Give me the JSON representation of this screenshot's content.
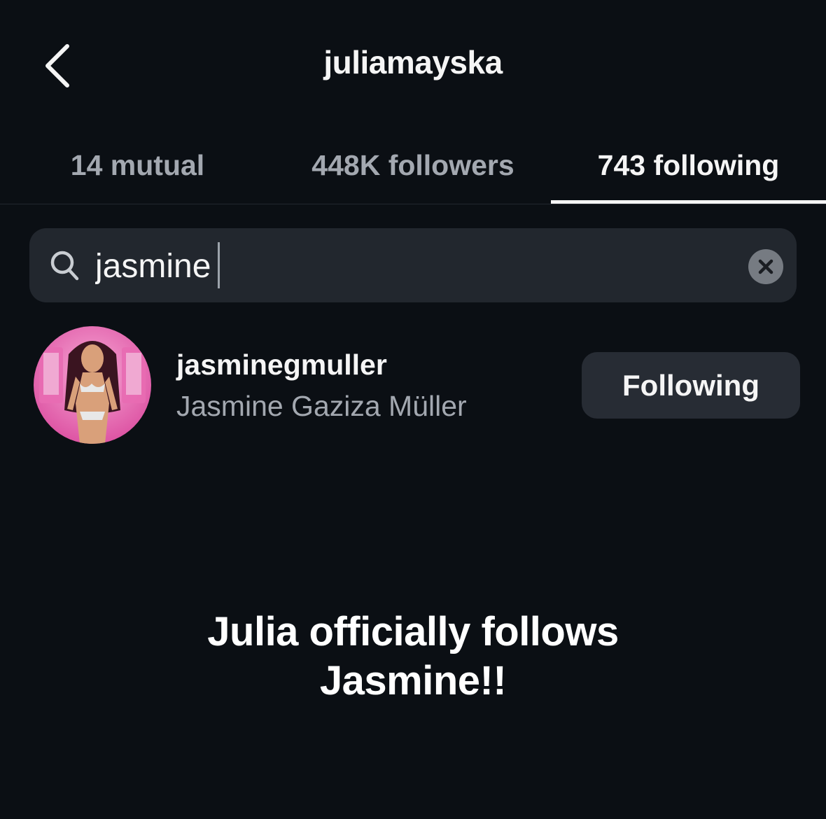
{
  "header": {
    "title": "juliamayska",
    "back_icon": "chevron-left-icon"
  },
  "tabs": [
    {
      "label": "14 mutual",
      "active": false
    },
    {
      "label": "448K followers",
      "active": false
    },
    {
      "label": "743 following",
      "active": true
    }
  ],
  "search": {
    "value": "jasmine",
    "search_icon": "search-icon",
    "clear_icon": "clear-icon"
  },
  "results": [
    {
      "username": "jasminegmuller",
      "full_name": "Jasmine Gaziza Müller",
      "button_label": "Following",
      "avatar_icon": "avatar"
    }
  ],
  "caption": {
    "line1": "Julia officially follows",
    "line2": "Jasmine!!"
  },
  "colors": {
    "background": "#0b0f14",
    "surface": "#22272e",
    "text_primary": "#f5f5f5",
    "text_secondary": "#a3a8b0",
    "avatar_accent": "#e04aa0"
  }
}
